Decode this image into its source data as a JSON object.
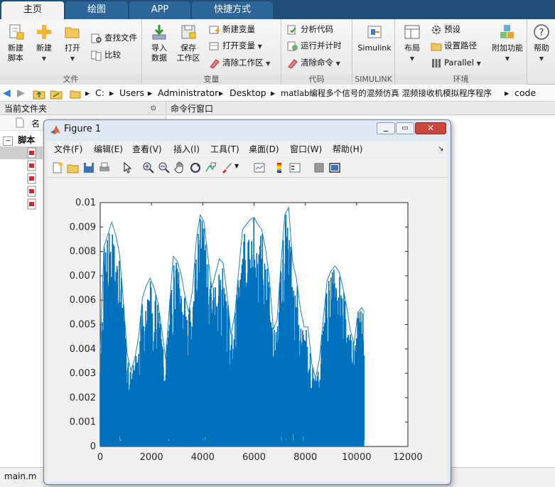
{
  "tabs": [
    {
      "label": "主页"
    },
    {
      "label": "绘图"
    },
    {
      "label": "APP"
    },
    {
      "label": "快捷方式"
    }
  ],
  "ribbon": {
    "file": {
      "label": "文件",
      "new_script": "新建\n脚本",
      "new": "新建",
      "open": "打开",
      "find_files": "查找文件",
      "compare": "比较"
    },
    "variable": {
      "label": "变量",
      "import": "导入\n数据",
      "save": "保存\n工作区",
      "new_var": "新建变量",
      "open_var": "打开变量",
      "clear_ws": "清除工作区"
    },
    "code": {
      "label": "代码",
      "analyze": "分析代码",
      "run_time": "运行并计时",
      "clear_cmd": "清除命令"
    },
    "simulink": {
      "label": "SIMULINK",
      "btn": "Simulink"
    },
    "env": {
      "label": "环境",
      "layout": "布局",
      "prefs": "预设",
      "set_path": "设置路径",
      "parallel": "Parallel",
      "addons": "附加功能"
    },
    "resources": {
      "help": "帮助"
    }
  },
  "address": {
    "parts": [
      "C:",
      "Users",
      "Administrator",
      "Desktop",
      "matlab编程多个信号的混频仿真 混频接收机模拟程序程序",
      "code"
    ]
  },
  "panels": {
    "current_folder": "当前文件夹",
    "command_window": "命令行窗口",
    "name_col": "名",
    "tree_root": "脚本",
    "status_file": "main.m"
  },
  "figure": {
    "title": "Figure 1",
    "menu": [
      "文件(F)",
      "编辑(E)",
      "查看(V)",
      "插入(I)",
      "工具(T)",
      "桌面(D)",
      "窗口(W)",
      "帮助(H)"
    ]
  },
  "chart_data": {
    "type": "line",
    "title": "",
    "xlabel": "",
    "ylabel": "",
    "xlim": [
      0,
      12000
    ],
    "ylim": [
      0,
      0.01
    ],
    "x_ticks": [
      "0",
      "2000",
      "4000",
      "6000",
      "8000",
      "10000",
      "12000"
    ],
    "y_ticks": [
      "0",
      "0.001",
      "0.002",
      "0.003",
      "0.004",
      "0.005",
      "0.006",
      "0.007",
      "0.008",
      "0.009",
      "0.01"
    ],
    "series": [
      {
        "color": "#0072bd",
        "envelope_x": [
          0,
          150,
          300,
          450,
          600,
          750,
          900,
          1050,
          1200,
          1350,
          1500,
          1650,
          1800,
          1950,
          2100,
          2250,
          2400,
          2550,
          2700,
          2850,
          3000,
          3150,
          3300,
          3450,
          3600,
          3750,
          3900,
          4050,
          4200,
          4350,
          4500,
          4650,
          4800,
          4950,
          5100,
          5250,
          5400,
          5550,
          5700,
          5850,
          6000,
          6150,
          6300,
          6450,
          6600,
          6750,
          6900,
          7050,
          7200,
          7350,
          7500,
          7650,
          7800,
          7950,
          8100,
          8250,
          8400,
          8550,
          8700,
          8850,
          9000,
          9150,
          9300,
          9450,
          9600,
          9750,
          9900,
          10050,
          10200,
          10300
        ],
        "envelope_y": [
          0.004,
          0.0082,
          0.0087,
          0.0092,
          0.0087,
          0.0079,
          0.006,
          0.0038,
          0.0031,
          0.0036,
          0.0045,
          0.0061,
          0.0066,
          0.0069,
          0.0065,
          0.0059,
          0.0048,
          0.0036,
          0.0057,
          0.0078,
          0.0076,
          0.0071,
          0.0062,
          0.0055,
          0.0064,
          0.0085,
          0.0095,
          0.0092,
          0.0078,
          0.0065,
          0.0071,
          0.0077,
          0.0075,
          0.0062,
          0.0046,
          0.0054,
          0.0072,
          0.0089,
          0.0091,
          0.0093,
          0.0094,
          0.0091,
          0.0089,
          0.0081,
          0.0069,
          0.0048,
          0.0052,
          0.0075,
          0.0095,
          0.0098,
          0.0076,
          0.0069,
          0.0057,
          0.0049,
          0.0049,
          0.0034,
          0.0028,
          0.0036,
          0.0052,
          0.0068,
          0.0072,
          0.0074,
          0.0072,
          0.0066,
          0.0058,
          0.0048,
          0.0042,
          0.0055,
          0.0057,
          0.0055
        ]
      }
    ]
  }
}
